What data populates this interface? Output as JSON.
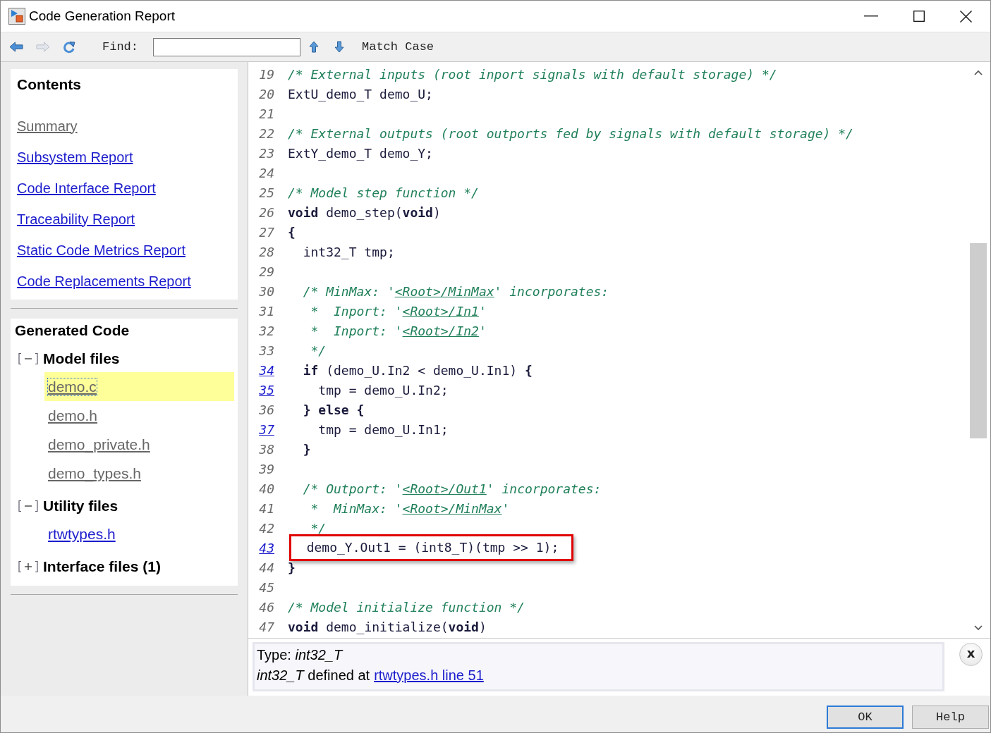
{
  "window": {
    "title": "Code Generation Report"
  },
  "toolbar": {
    "nav_buttons": [
      {
        "kind": "back",
        "disabled": false
      },
      {
        "kind": "forward",
        "disabled": true
      },
      {
        "kind": "refresh",
        "disabled": false
      }
    ],
    "find_label": "Find:",
    "match_case": "Match Case"
  },
  "contents": {
    "title": "Contents",
    "links": [
      {
        "label": "Summary",
        "visited": true
      },
      {
        "label": "Subsystem Report",
        "visited": false
      },
      {
        "label": "Code Interface Report",
        "visited": false
      },
      {
        "label": "Traceability Report",
        "visited": false
      },
      {
        "label": "Static Code Metrics Report",
        "visited": false
      },
      {
        "label": "Code Replacements Report",
        "visited": false
      }
    ]
  },
  "generated_code": {
    "title": "Generated Code",
    "groups": [
      {
        "label": "Model files",
        "expanded": true,
        "files": [
          {
            "label": "demo.c",
            "visited": true,
            "selected": true
          },
          {
            "label": "demo.h",
            "visited": true,
            "selected": false
          },
          {
            "label": "demo_private.h",
            "visited": true,
            "selected": false
          },
          {
            "label": "demo_types.h",
            "visited": true,
            "selected": false
          }
        ]
      },
      {
        "label": "Utility files",
        "expanded": true,
        "files": [
          {
            "label": "rtwtypes.h",
            "visited": false,
            "selected": false
          }
        ]
      },
      {
        "label": "Interface files (1)",
        "expanded": false
      }
    ]
  },
  "code_lines": [
    {
      "number": "19",
      "linked": false,
      "highlighted": false,
      "segments": [
        {
          "kind": "comment",
          "text": "/* External inputs (root inport signals with default storage) */"
        }
      ]
    },
    {
      "number": "20",
      "linked": false,
      "highlighted": false,
      "segments": [
        {
          "kind": "code",
          "text": "ExtU_demo_T demo_U;"
        }
      ]
    },
    {
      "number": "21",
      "linked": false,
      "highlighted": false
    },
    {
      "number": "22",
      "linked": false,
      "highlighted": false,
      "segments": [
        {
          "kind": "comment",
          "text": "/* External outputs (root outports fed by signals with default storage) */"
        }
      ]
    },
    {
      "number": "23",
      "linked": false,
      "highlighted": false,
      "segments": [
        {
          "kind": "code",
          "text": "ExtY_demo_T demo_Y;"
        }
      ]
    },
    {
      "number": "24",
      "linked": false,
      "highlighted": false
    },
    {
      "number": "25",
      "linked": false,
      "highlighted": false,
      "segments": [
        {
          "kind": "comment",
          "text": "/* Model step function */"
        }
      ]
    },
    {
      "number": "26",
      "linked": false,
      "highlighted": false,
      "segments": [
        {
          "kind": "keyword",
          "text": "void"
        },
        {
          "kind": "code",
          "text": " demo_step("
        },
        {
          "kind": "keyword",
          "text": "void"
        },
        {
          "kind": "code",
          "text": ")"
        }
      ]
    },
    {
      "number": "27",
      "linked": false,
      "highlighted": false,
      "segments": [
        {
          "kind": "keyword",
          "text": "{"
        }
      ]
    },
    {
      "number": "28",
      "linked": false,
      "highlighted": false,
      "segments": [
        {
          "kind": "code",
          "text": "  int32_T tmp;"
        }
      ]
    },
    {
      "number": "29",
      "linked": false,
      "highlighted": false
    },
    {
      "number": "30",
      "linked": false,
      "highlighted": false,
      "segments": [
        {
          "kind": "comment",
          "text": "  /* MinMax: '"
        },
        {
          "kind": "link",
          "text": "<Root>/MinMax"
        },
        {
          "kind": "comment",
          "text": "' incorporates:"
        }
      ]
    },
    {
      "number": "31",
      "linked": false,
      "highlighted": false,
      "segments": [
        {
          "kind": "comment",
          "text": "   *  Inport: '"
        },
        {
          "kind": "link",
          "text": "<Root>/In1"
        },
        {
          "kind": "comment",
          "text": "'"
        }
      ]
    },
    {
      "number": "32",
      "linked": false,
      "highlighted": false,
      "segments": [
        {
          "kind": "comment",
          "text": "   *  Inport: '"
        },
        {
          "kind": "link",
          "text": "<Root>/In2"
        },
        {
          "kind": "comment",
          "text": "'"
        }
      ]
    },
    {
      "number": "33",
      "linked": false,
      "highlighted": false,
      "segments": [
        {
          "kind": "comment",
          "text": "   */"
        }
      ]
    },
    {
      "number": "34",
      "linked": true,
      "highlighted": false,
      "segments": [
        {
          "kind": "keyword",
          "text": "  if"
        },
        {
          "kind": "code",
          "text": " (demo_U.In2 < demo_U.In1) "
        },
        {
          "kind": "keyword",
          "text": "{"
        }
      ]
    },
    {
      "number": "35",
      "linked": true,
      "highlighted": false,
      "segments": [
        {
          "kind": "code",
          "text": "    tmp = demo_U.In2;"
        }
      ]
    },
    {
      "number": "36",
      "linked": false,
      "highlighted": false,
      "segments": [
        {
          "kind": "keyword",
          "text": "  } else {"
        }
      ]
    },
    {
      "number": "37",
      "linked": true,
      "highlighted": false,
      "segments": [
        {
          "kind": "code",
          "text": "    tmp = demo_U.In1;"
        }
      ]
    },
    {
      "number": "38",
      "linked": false,
      "highlighted": false,
      "segments": [
        {
          "kind": "keyword",
          "text": "  }"
        }
      ]
    },
    {
      "number": "39",
      "linked": false,
      "highlighted": false
    },
    {
      "number": "40",
      "linked": false,
      "highlighted": false,
      "segments": [
        {
          "kind": "comment",
          "text": "  /* Outport: '"
        },
        {
          "kind": "link",
          "text": "<Root>/Out1"
        },
        {
          "kind": "comment",
          "text": "' incorporates:"
        }
      ]
    },
    {
      "number": "41",
      "linked": false,
      "highlighted": false,
      "segments": [
        {
          "kind": "comment",
          "text": "   *  MinMax: '"
        },
        {
          "kind": "link",
          "text": "<Root>/MinMax"
        },
        {
          "kind": "comment",
          "text": "'"
        }
      ]
    },
    {
      "number": "42",
      "linked": false,
      "highlighted": false,
      "segments": [
        {
          "kind": "comment",
          "text": "   */"
        }
      ]
    },
    {
      "number": "43",
      "linked": true,
      "highlighted": true,
      "segments": [
        {
          "kind": "code",
          "text": "  demo_Y.Out1 = (int8_T)(tmp >> 1);"
        }
      ]
    },
    {
      "number": "44",
      "linked": false,
      "highlighted": false,
      "segments": [
        {
          "kind": "keyword",
          "text": "}"
        }
      ]
    },
    {
      "number": "45",
      "linked": false,
      "highlighted": false
    },
    {
      "number": "46",
      "linked": false,
      "highlighted": false,
      "segments": [
        {
          "kind": "comment",
          "text": "/* Model initialize function */"
        }
      ]
    },
    {
      "number": "47",
      "linked": false,
      "highlighted": false,
      "segments": [
        {
          "kind": "keyword",
          "text": "void"
        },
        {
          "kind": "code",
          "text": " demo_initialize("
        },
        {
          "kind": "keyword",
          "text": "void"
        },
        {
          "kind": "code",
          "text": ")"
        }
      ]
    }
  ],
  "info": {
    "type_line": "Type: *int32_T*",
    "definition": "*int32_T* defined at",
    "link": "rtwtypes.h line 51",
    "close": "x"
  },
  "buttons": [
    {
      "label": "OK",
      "default": true
    },
    {
      "label": "Help",
      "default": false
    }
  ]
}
